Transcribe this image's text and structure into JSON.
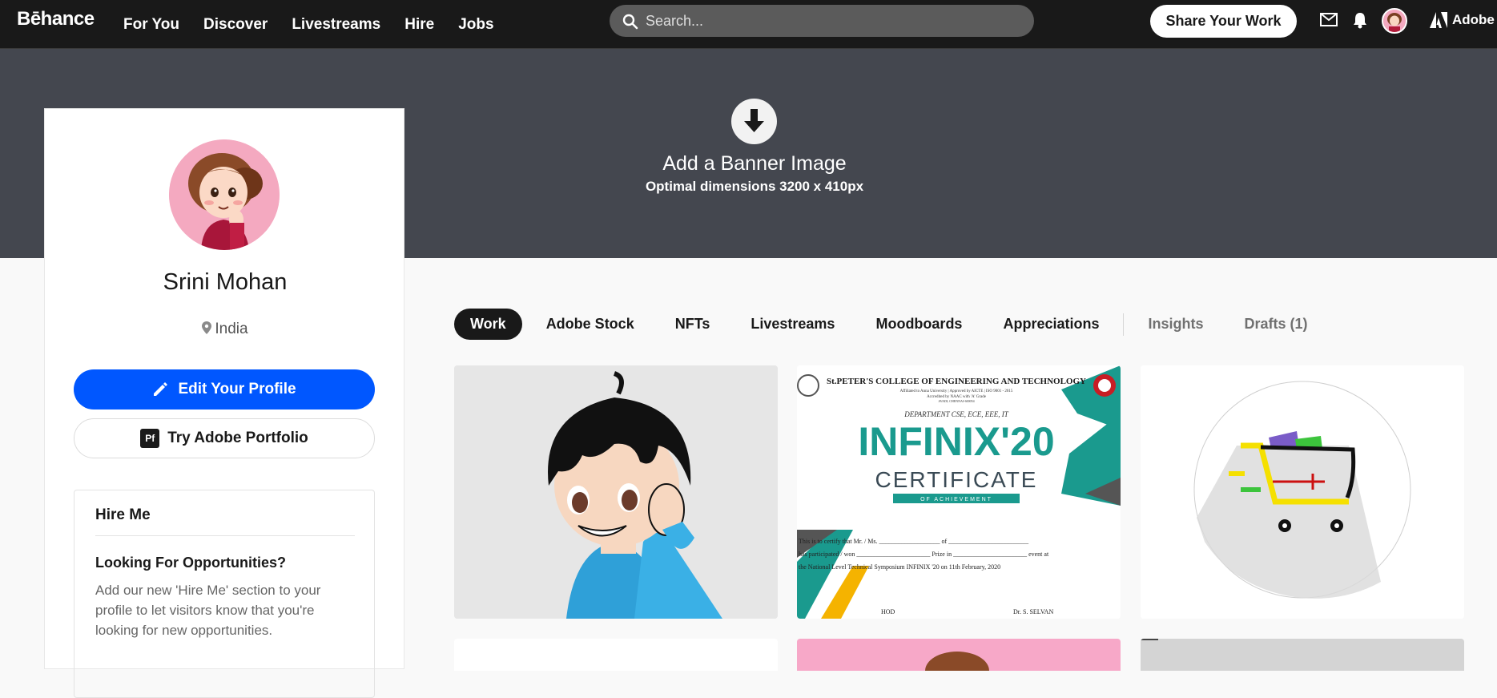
{
  "nav": {
    "logo": "Bēhance",
    "links": [
      "For You",
      "Discover",
      "Livestreams",
      "Hire",
      "Jobs"
    ],
    "search_placeholder": "Search...",
    "share_label": "Share Your Work",
    "adobe_label": "Adobe"
  },
  "banner": {
    "title": "Add a Banner Image",
    "subtitle": "Optimal dimensions 3200 x 410px"
  },
  "profile": {
    "name": "Srini Mohan",
    "location": "India",
    "edit_label": "Edit Your Profile",
    "portfolio_label": "Try Adobe Portfolio",
    "portfolio_badge": "Pf",
    "hire": {
      "title": "Hire Me",
      "subtitle": "Looking For Opportunities?",
      "body": "Add our new 'Hire Me' section to your profile to let visitors know that you're looking for new opportunities."
    }
  },
  "tabs": {
    "work": "Work",
    "adobe_stock": "Adobe Stock",
    "nfts": "NFTs",
    "livestreams": "Livestreams",
    "moodboards": "Moodboards",
    "appreciations": "Appreciations",
    "insights": "Insights",
    "drafts": "Drafts (1)"
  },
  "projects": {
    "certificate": {
      "college": "St.PETER'S COLLEGE OF ENGINEERING AND TECHNOLOGY",
      "affiliation": "Affiliated to Anna University | Approved by AICTE | ISO 9001 - 2015",
      "accreditation": "Accredited by NAAC with 'A' Grade",
      "address": "AVADI, CHENNAI-600054",
      "departments": "DEPARTMENT CSE, ECE, EEE, IT",
      "event": "INFINIX'20",
      "heading": "CERTIFICATE",
      "ribbon": "OF ACHIEVEMENT",
      "line1": "This is to certify that Mr. / Ms. ___________________ of _________________________",
      "line2": "has participated / won _______________________ Prize in _______________________ event at",
      "line3": "the National Level Technical Symposium INFINIX '20 on 11th February, 2020",
      "sign_left": "HOD",
      "sign_right": "Dr. S. SELVAN"
    }
  },
  "colors": {
    "nav_bg": "#191919",
    "banner_bg": "#44474f",
    "primary_blue": "#0057ff",
    "avatar_pink": "#f4a9c0"
  }
}
